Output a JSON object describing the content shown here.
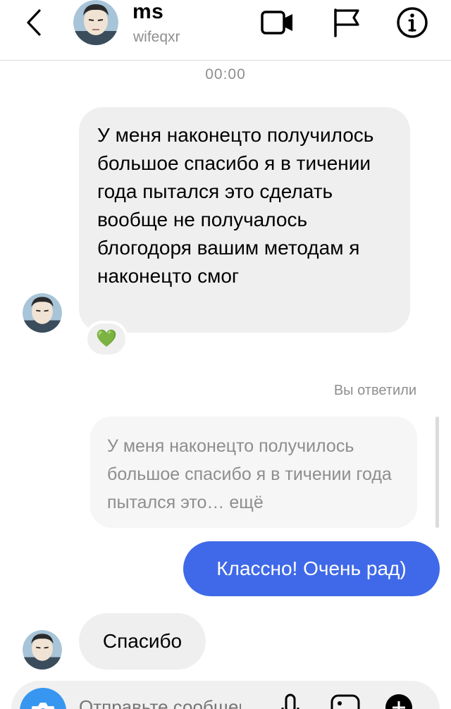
{
  "header": {
    "back_icon": "chevron-left-icon",
    "username": "ms",
    "handle": "wifeqxr",
    "video_icon": "video-camera-icon",
    "flag_icon": "flag-icon",
    "info_icon": "info-icon"
  },
  "timestamp": "00:00",
  "messages": [
    {
      "direction": "incoming",
      "text": "У меня наконецто получилось большое спасибо я в тичении года пытался это сделать вообще не получалось блогодоря вашим методам я наконецто смог",
      "reaction": "💚"
    },
    {
      "direction": "outgoing",
      "reply_label": "Вы ответили",
      "quoted_text": "У меня наконецто получилось большое спасибо я в тичении года пытался это… ещё",
      "text": "Классно! Очень рад)"
    },
    {
      "direction": "incoming",
      "text": "Спасибо"
    }
  ],
  "composer": {
    "placeholder": "Отправьте сообщение...",
    "camera_icon": "camera-icon",
    "mic_icon": "microphone-icon",
    "gallery_icon": "gallery-icon",
    "plus_icon": "plus-icon"
  },
  "colors": {
    "outgoing_bubble": "#3f69e8",
    "incoming_bubble": "#efefef",
    "secondary_text": "#8e8e8e",
    "camera_button": "#3797f0"
  }
}
